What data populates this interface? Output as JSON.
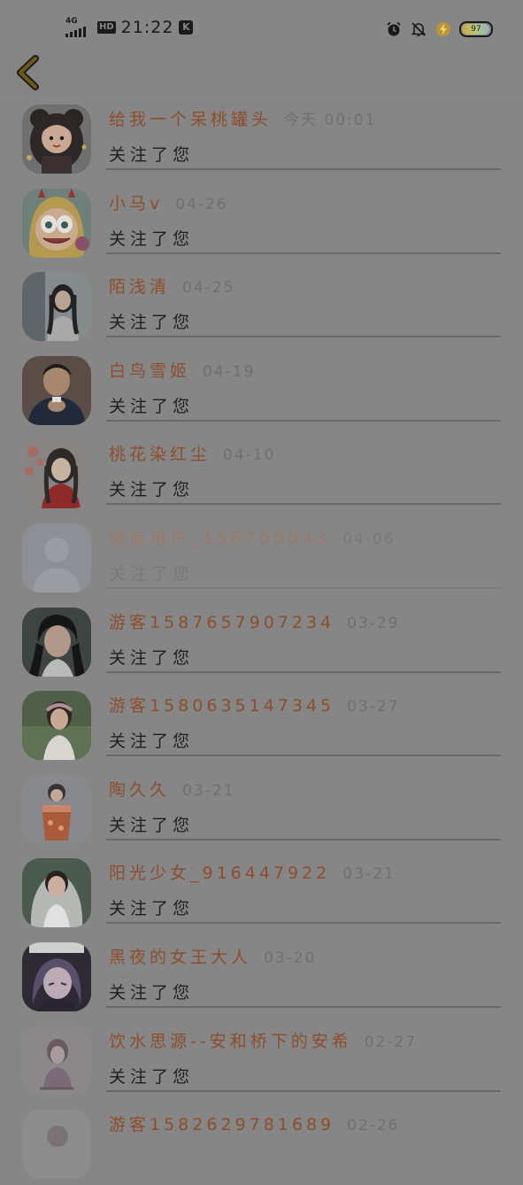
{
  "status_bar": {
    "network": "4G",
    "hd": "HD",
    "time": "21:22",
    "k_badge": "K",
    "battery": "97",
    "icons": [
      "alarm-icon",
      "mute-icon",
      "charging-icon",
      "battery-icon"
    ]
  },
  "nav": {
    "back_icon": "chevron-left-icon",
    "accent": "#3a2f10"
  },
  "follow_list": [
    {
      "name": "给我一个呆桃罐头",
      "date": "今天 00:01",
      "action": "关注了您",
      "avatar": "bear-girl-avatar"
    },
    {
      "name": "小马v",
      "date": "04-26",
      "action": "关注了您",
      "avatar": "cartoon-star-avatar"
    },
    {
      "name": "陌浅清",
      "date": "04-25",
      "action": "关注了您",
      "avatar": "girl-photo-avatar"
    },
    {
      "name": "白鸟雪姬",
      "date": "04-19",
      "action": "关注了您",
      "avatar": "man-photo-avatar"
    },
    {
      "name": "桃花染红尘",
      "date": "04-10",
      "action": "关注了您",
      "avatar": "illustrated-girl-avatar"
    },
    {
      "name": "微信用户_156700043",
      "date": "04-06",
      "action": "关注了您",
      "avatar": "default-avatar"
    },
    {
      "name": "游客1587657907234",
      "date": "03-29",
      "action": "关注了您",
      "avatar": "ancient-man-avatar"
    },
    {
      "name": "游客1580635147345",
      "date": "03-27",
      "action": "关注了您",
      "avatar": "child-photo-avatar"
    },
    {
      "name": "陶久久",
      "date": "03-21",
      "action": "关注了您",
      "avatar": "drink-avatar"
    },
    {
      "name": "阳光少女_916447922",
      "date": "03-21",
      "action": "关注了您",
      "avatar": "bride-avatar"
    },
    {
      "name": "黑夜的女王大人",
      "date": "03-20",
      "action": "关注了您",
      "avatar": "anime-girl-avatar"
    },
    {
      "name": "饮水思源--安和桥下的安希",
      "date": "02-27",
      "action": "关注了您",
      "avatar": "sketch-girl-avatar"
    },
    {
      "name": "游客1582629781689",
      "date": "02-26",
      "action": "",
      "avatar": "partial-avatar"
    }
  ]
}
